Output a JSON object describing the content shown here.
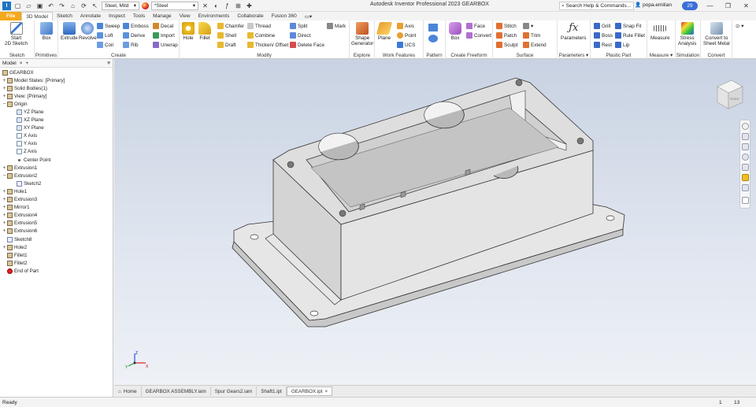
{
  "titlebar": {
    "material": "Steel, Mild",
    "appearance": "*Steel",
    "title": "Autodesk Inventor Professional 2023   GEARBOX",
    "search_placeholder": "Search Help & Commands...",
    "user": "popa.emilian",
    "notifications": "29",
    "icons": [
      "new-icon",
      "open-icon",
      "save-icon",
      "undo-icon",
      "redo-icon",
      "home-icon",
      "update-icon",
      "select-icon",
      "material-swatch-icon"
    ]
  },
  "tabs": [
    "File",
    "3D Model",
    "Sketch",
    "Annotate",
    "Inspect",
    "Tools",
    "Manage",
    "View",
    "Environments",
    "Collaborate",
    "Fusion 360"
  ],
  "active_tab": "3D Model",
  "ribbon": {
    "panels": [
      {
        "label": "Sketch"
      },
      {
        "label": "Primitives"
      },
      {
        "label": "Create"
      },
      {
        "label": "Modify"
      },
      {
        "label": "Explore"
      },
      {
        "label": "Work Features"
      },
      {
        "label": "Pattern"
      },
      {
        "label": "Create Freeform"
      },
      {
        "label": "Surface"
      },
      {
        "label": "Parameters ▾"
      },
      {
        "label": "Plastic Part"
      },
      {
        "label": "Measure ▾"
      },
      {
        "label": "Simulation"
      },
      {
        "label": "Convert"
      }
    ],
    "sketch": {
      "start": "Start",
      "start2": "2D Sketch"
    },
    "primitives": {
      "box": "Box"
    },
    "create": {
      "extrude": "Extrude",
      "revolve": "Revolve",
      "sweep": "Sweep",
      "loft": "Loft",
      "coil": "Coil",
      "emboss": "Emboss",
      "derive": "Derive",
      "rib": "Rib",
      "decal": "Decal",
      "import": "Import",
      "unwrap": "Unwrap"
    },
    "modify": {
      "hole": "Hole",
      "fillet": "Fillet",
      "chamfer": "Chamfer",
      "shell": "Shell",
      "draft": "Draft",
      "thread": "Thread",
      "combine": "Combine",
      "thicken": "Thicken/ Offset",
      "split": "Split",
      "direct": "Direct",
      "delete_face": "Delete Face",
      "mark": "Mark"
    },
    "explore": {
      "shape": "Shape",
      "shape2": "Generator"
    },
    "work": {
      "plane": "Plane",
      "axis": "Axis",
      "point": "Point",
      "ucs": "UCS"
    },
    "freeform": {
      "box": "Box",
      "face": "Face",
      "convert": "Convert"
    },
    "surface": {
      "stitch": "Stitch",
      "patch": "Patch",
      "sculpt": "Sculpt",
      "trim": "Trim",
      "extend": "Extend"
    },
    "parameters": {
      "label": "Parameters"
    },
    "plastic": {
      "grill": "Grill",
      "boss": "Boss",
      "rest": "Rest",
      "snap": "Snap Fit",
      "rule": "Rule Fillet",
      "lip": "Lip"
    },
    "measure": {
      "label": "Measure"
    },
    "simulation": {
      "stress": "Stress",
      "stress2": "Analysis"
    },
    "convert": {
      "to": "Convert to",
      "to2": "Sheet Metal"
    }
  },
  "browser": {
    "tab": "Model",
    "root": "GEARBOX",
    "nodes": [
      {
        "label": "Model States: [Primary]",
        "icon": "feat",
        "exp": "+",
        "indent": 0
      },
      {
        "label": "Solid Bodies(1)",
        "icon": "feat",
        "exp": "+",
        "indent": 0
      },
      {
        "label": "View: [Primary]",
        "icon": "feat",
        "exp": "+",
        "indent": 0
      },
      {
        "label": "Origin",
        "icon": "feat",
        "exp": "−",
        "indent": 0
      },
      {
        "label": "YZ Plane",
        "icon": "plane",
        "exp": "",
        "indent": 1
      },
      {
        "label": "XZ Plane",
        "icon": "plane",
        "exp": "",
        "indent": 1
      },
      {
        "label": "XY Plane",
        "icon": "plane",
        "exp": "",
        "indent": 1
      },
      {
        "label": "X Axis",
        "icon": "axis",
        "exp": "",
        "indent": 1
      },
      {
        "label": "Y Axis",
        "icon": "axis",
        "exp": "",
        "indent": 1
      },
      {
        "label": "Z Axis",
        "icon": "axis",
        "exp": "",
        "indent": 1
      },
      {
        "label": "Center Point",
        "icon": "point",
        "exp": "",
        "indent": 1
      },
      {
        "label": "Extrusion1",
        "icon": "feat",
        "exp": "+",
        "indent": 0
      },
      {
        "label": "Extrusion2",
        "icon": "feat",
        "exp": "−",
        "indent": 0
      },
      {
        "label": "Sketch2",
        "icon": "sketch",
        "exp": "",
        "indent": 1
      },
      {
        "label": "Hole1",
        "icon": "feat",
        "exp": "+",
        "indent": 0
      },
      {
        "label": "Extrusion3",
        "icon": "feat",
        "exp": "+",
        "indent": 0
      },
      {
        "label": "Mirror1",
        "icon": "feat",
        "exp": "+",
        "indent": 0
      },
      {
        "label": "Extrusion4",
        "icon": "feat",
        "exp": "+",
        "indent": 0
      },
      {
        "label": "Extrusion5",
        "icon": "feat",
        "exp": "+",
        "indent": 0
      },
      {
        "label": "Extrusion6",
        "icon": "feat",
        "exp": "+",
        "indent": 0
      },
      {
        "label": "Sketch8",
        "icon": "sketch",
        "exp": "",
        "indent": 0
      },
      {
        "label": "Hole2",
        "icon": "feat",
        "exp": "+",
        "indent": 0
      },
      {
        "label": "Fillet1",
        "icon": "feat",
        "exp": "",
        "indent": 0
      },
      {
        "label": "Fillet2",
        "icon": "feat",
        "exp": "",
        "indent": 0
      },
      {
        "label": "End of Part",
        "icon": "end",
        "exp": "",
        "indent": 0
      }
    ]
  },
  "viewport": {
    "viewcube_label": "FRONT",
    "triad": [
      "X",
      "Y",
      "Z"
    ]
  },
  "doctabs": [
    {
      "label": "Home",
      "active": false
    },
    {
      "label": "GEARBOX ASSEMBLY.iam",
      "active": false
    },
    {
      "label": "Spur Gears2.iam",
      "active": false
    },
    {
      "label": "Shaft1.ipt",
      "active": false
    },
    {
      "label": "GEARBOX.ipt",
      "active": true
    }
  ],
  "status": {
    "left": "Ready",
    "count1": "1",
    "count2": "13"
  }
}
